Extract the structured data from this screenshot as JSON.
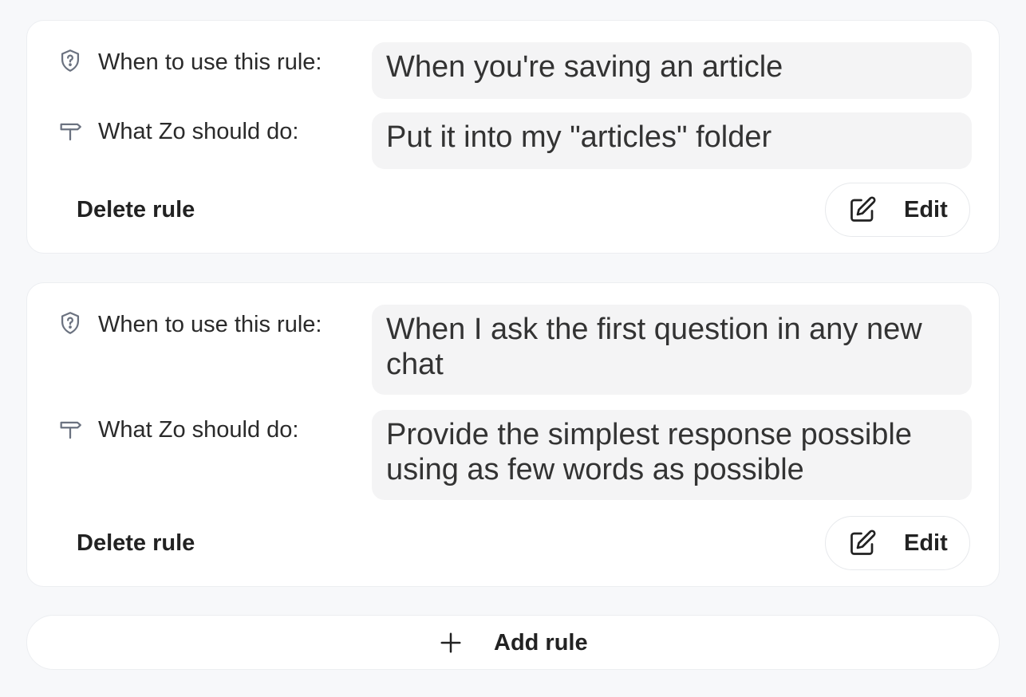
{
  "rules": [
    {
      "when_label": "When to use this rule:",
      "when_value": "When you're saving an article",
      "what_label": "What Zo should do:",
      "what_value": "Put it into my \"articles\" folder",
      "delete_label": "Delete rule",
      "edit_label": "Edit"
    },
    {
      "when_label": "When to use this rule:",
      "when_value": "When I ask the first question in any new chat",
      "what_label": "What Zo should do:",
      "what_value": "Provide the simplest response possible using as few words as possible",
      "delete_label": "Delete rule",
      "edit_label": "Edit"
    }
  ],
  "add_rule_label": "Add rule",
  "icons": {
    "when": "shield-question-icon",
    "what": "signpost-icon",
    "edit": "edit-icon",
    "add": "plus-icon"
  },
  "colors": {
    "background": "#f7f8fa",
    "card": "#ffffff",
    "field": "#f4f4f5",
    "icon": "#6b7280",
    "text": "#222222"
  }
}
